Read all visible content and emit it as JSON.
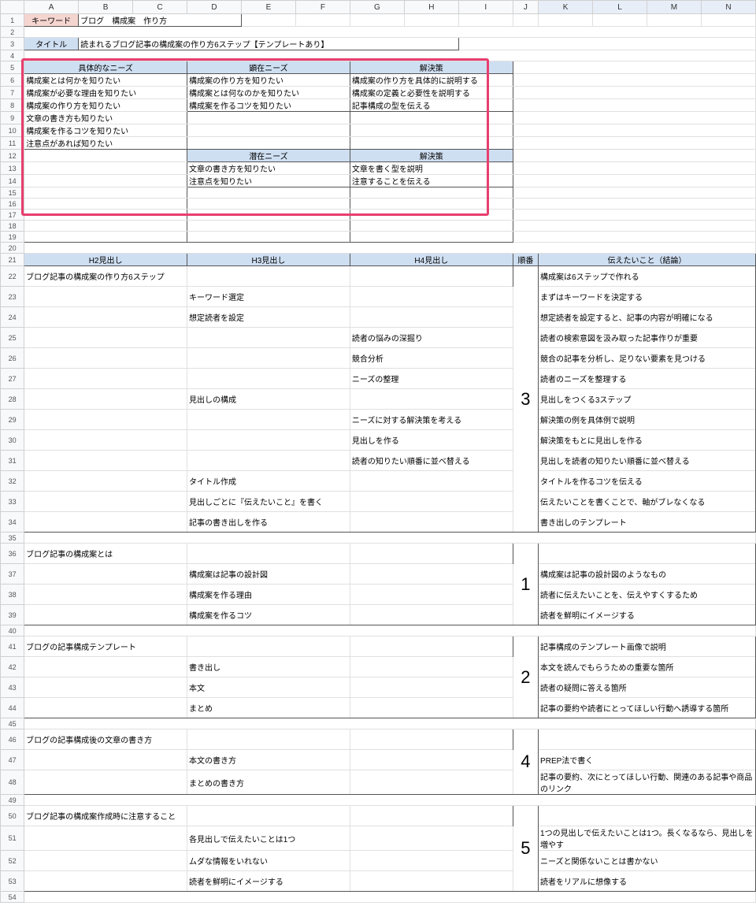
{
  "columns": [
    "A",
    "B",
    "C",
    "D",
    "E",
    "F",
    "G",
    "H",
    "I",
    "J",
    "K",
    "L",
    "M",
    "N"
  ],
  "labels": {
    "keyword": "キーワード",
    "keyword_val": "ブログ　構成案　作り方",
    "title": "タイトル",
    "title_val": "読まれるブログ記事の構成案の作り方6ステップ【テンプレートあり】"
  },
  "nheaders": {
    "gutai": "具体的なニーズ",
    "kenzai": "顕在ニーズ",
    "kaiketsu": "解決策",
    "senzai": "潜在ニーズ"
  },
  "needs_rows": [
    [
      "構成案とは何かを知りたい",
      "構成案の作り方を知りたい",
      "構成案の作り方を具体的に説明する"
    ],
    [
      "構成案が必要な理由を知りたい",
      "構成案とは何なのかを知りたい",
      "構成案の定義と必要性を説明する"
    ],
    [
      "構成案の作り方を知りたい",
      "構成案を作るコツを知りたい",
      "記事構成の型を伝える"
    ],
    [
      "文章の書き方も知りたい",
      "",
      ""
    ],
    [
      "構成案を作るコツを知りたい",
      "",
      ""
    ],
    [
      "注意点があれば知りたい",
      "",
      ""
    ]
  ],
  "latent_rows": [
    [
      "文章の書き方を知りたい",
      "文章を書く型を説明"
    ],
    [
      "注意点を知りたい",
      "注意することを伝える"
    ]
  ],
  "oheaders": {
    "h2": "H2見出し",
    "h3": "H3見出し",
    "h4": "H4見出し",
    "order": "順番",
    "msg": "伝えたいこと（結論）"
  },
  "sections": [
    {
      "order": "3",
      "rows": [
        [
          "ブログ記事の構成案の作り方6ステップ",
          "",
          "",
          "構成案は6ステップで作れる"
        ],
        [
          "",
          "キーワード選定",
          "",
          "まずはキーワードを決定する"
        ],
        [
          "",
          "想定読者を設定",
          "",
          "想定読者を設定すると、記事の内容が明確になる"
        ],
        [
          "",
          "",
          "読者の悩みの深掘り",
          "読者の検索意図を汲み取った記事作りが重要"
        ],
        [
          "",
          "",
          "競合分析",
          "競合の記事を分析し、足りない要素を見つける"
        ],
        [
          "",
          "",
          "ニーズの整理",
          "読者のニーズを整理する"
        ],
        [
          "",
          "見出しの構成",
          "",
          "見出しをつくる3ステップ"
        ],
        [
          "",
          "",
          "ニーズに対する解決策を考える",
          "解決策の例を具体例で説明"
        ],
        [
          "",
          "",
          "見出しを作る",
          "解決策をもとに見出しを作る"
        ],
        [
          "",
          "",
          "読者の知りたい順番に並べ替える",
          "見出しを読者の知りたい順番に並べ替える"
        ],
        [
          "",
          "タイトル作成",
          "",
          "タイトルを作るコツを伝える"
        ],
        [
          "",
          "見出しごとに『伝えたいこと』を書く",
          "",
          "伝えたいことを書くことで、軸がブレなくなる"
        ],
        [
          "",
          "記事の書き出しを作る",
          "",
          "書き出しのテンプレート"
        ]
      ]
    },
    {
      "order": "1",
      "rows": [
        [
          "ブログ記事の構成案とは",
          "",
          "",
          ""
        ],
        [
          "",
          "構成案は記事の設計図",
          "",
          "構成案は記事の設計図のようなもの"
        ],
        [
          "",
          "構成案を作る理由",
          "",
          "読者に伝えたいことを、伝えやすくするため"
        ],
        [
          "",
          "構成案を作るコツ",
          "",
          "読者を鮮明にイメージする"
        ]
      ]
    },
    {
      "order": "2",
      "rows": [
        [
          "ブログの記事構成テンプレート",
          "",
          "",
          "記事構成のテンプレート画像で説明"
        ],
        [
          "",
          "書き出し",
          "",
          "本文を読んでもらうための重要な箇所"
        ],
        [
          "",
          "本文",
          "",
          "読者の疑問に答える箇所"
        ],
        [
          "",
          "まとめ",
          "",
          "記事の要約や読者にとってほしい行動へ誘導する箇所"
        ]
      ]
    },
    {
      "order": "4",
      "rows": [
        [
          "ブログの記事構成後の文章の書き方",
          "",
          "",
          ""
        ],
        [
          "",
          "本文の書き方",
          "",
          "PREP法で書く"
        ],
        [
          "",
          "まとめの書き方",
          "",
          "記事の要約、次にとってほしい行動、関連のある記事や商品のリンク"
        ]
      ]
    },
    {
      "order": "5",
      "rows": [
        [
          "ブログ記事の構成案作成時に注意すること",
          "",
          "",
          ""
        ],
        [
          "",
          "各見出しで伝えたいことは1つ",
          "",
          "1つの見出しで伝えたいことは1つ。長くなるなら、見出しを増やす"
        ],
        [
          "",
          "ムダな情報をいれない",
          "",
          "ニーズと関係ないことは書かない"
        ],
        [
          "",
          "読者を鮮明にイメージする",
          "",
          "読者をリアルに想像する"
        ]
      ]
    }
  ]
}
